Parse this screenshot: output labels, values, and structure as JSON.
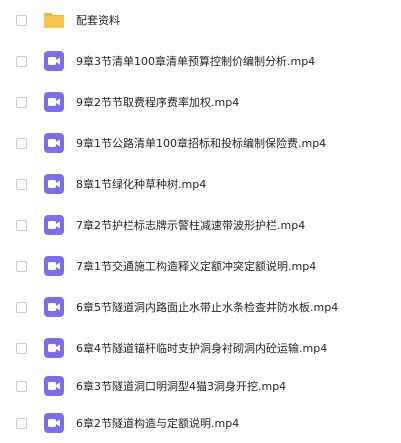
{
  "colors": {
    "folder": "#f6c54a",
    "folder_tab": "#f0b73a",
    "video": "#7b6cf0",
    "checkbox_border": "#c8cbd3",
    "text": "#1f2329"
  },
  "files": [
    {
      "name": "配套资料",
      "icon": "folder-icon"
    },
    {
      "name": "9章3节清单100章清单预算控制价编制分析.mp4",
      "icon": "video-file-icon"
    },
    {
      "name": "9章2节节取费程序费率加权.mp4",
      "icon": "video-file-icon"
    },
    {
      "name": "9章1节公路清单100章招标和投标编制保险费.mp4",
      "icon": "video-file-icon"
    },
    {
      "name": "8章1节绿化种草种树.mp4",
      "icon": "video-file-icon"
    },
    {
      "name": "7章2节护栏标志牌示警柱减速带波形护栏.mp4",
      "icon": "video-file-icon"
    },
    {
      "name": "7章1节交通施工构造释义定额冲突定额说明.mp4",
      "icon": "video-file-icon"
    },
    {
      "name": "6章5节隧道洞内路面止水带止水条检查井防水板.mp4",
      "icon": "video-file-icon"
    },
    {
      "name": "6章4节隧道锚杆临时支护洞身衬砌洞内砼运输.mp4",
      "icon": "video-file-icon"
    },
    {
      "name": "6章3节隧道洞口明洞型4猫3洞身开挖.mp4",
      "icon": "video-file-icon"
    },
    {
      "name": "6章2节隧道构造与定额说明.mp4",
      "icon": "video-file-icon"
    }
  ]
}
